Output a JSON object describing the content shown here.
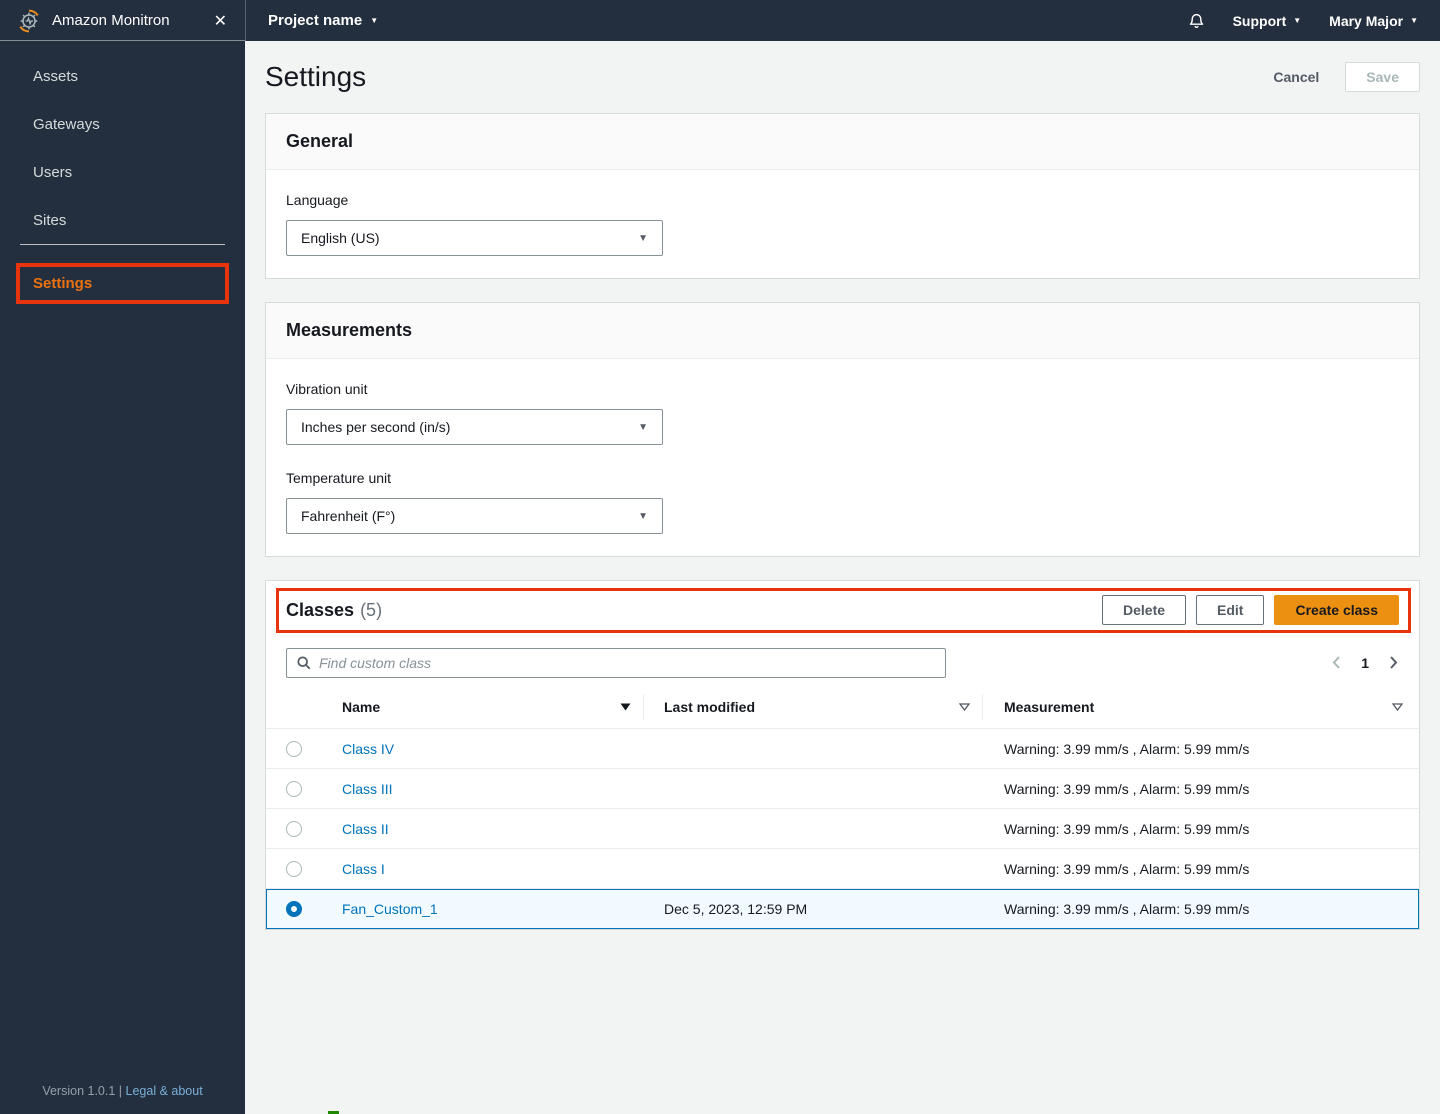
{
  "topbar": {
    "project": "Project name",
    "support": "Support",
    "user": "Mary Major"
  },
  "sidebar": {
    "app_name": "Amazon Monitron",
    "items": [
      {
        "label": "Assets"
      },
      {
        "label": "Gateways"
      },
      {
        "label": "Users"
      },
      {
        "label": "Sites"
      }
    ],
    "settings_label": "Settings",
    "version": "Version 1.0.1",
    "footer_divider": "|",
    "legal_link": "Legal & about"
  },
  "page": {
    "title": "Settings",
    "cancel_label": "Cancel",
    "save_label": "Save"
  },
  "general": {
    "title": "General",
    "language_label": "Language",
    "language_value": "English (US)"
  },
  "measurements": {
    "title": "Measurements",
    "vibration_label": "Vibration unit",
    "vibration_value": "Inches per second (in/s)",
    "temperature_label": "Temperature unit",
    "temperature_value": "Fahrenheit (F°)"
  },
  "classes": {
    "title": "Classes",
    "count": "(5)",
    "buttons": {
      "delete": "Delete",
      "edit": "Edit",
      "create": "Create class"
    },
    "search_placeholder": "Find custom class",
    "pagination": {
      "page": "1"
    },
    "table": {
      "columns": [
        "Name",
        "Last modified",
        "Measurement"
      ],
      "rows": [
        {
          "name": "Class IV",
          "modified": "",
          "measurement": "Warning: 3.99 mm/s , Alarm: 5.99 mm/s",
          "selected": false
        },
        {
          "name": "Class III",
          "modified": "",
          "measurement": "Warning: 3.99 mm/s , Alarm: 5.99 mm/s",
          "selected": false
        },
        {
          "name": "Class II",
          "modified": "",
          "measurement": "Warning: 3.99 mm/s , Alarm: 5.99 mm/s",
          "selected": false
        },
        {
          "name": "Class I",
          "modified": "",
          "measurement": "Warning: 3.99 mm/s , Alarm: 5.99 mm/s",
          "selected": false
        },
        {
          "name": "Fan_Custom_1",
          "modified": "Dec 5, 2023, 12:59 PM",
          "measurement": "Warning: 3.99 mm/s , Alarm: 5.99 mm/s",
          "selected": true
        }
      ]
    }
  },
  "icons": {
    "close": "✕",
    "caret_down": "▼",
    "select_caret": "▼"
  },
  "colors": {
    "topbar_bg": "#232f3e",
    "accent_orange": "#ec7211",
    "primary_button": "#ec9012",
    "link_blue": "#0073bb",
    "annotation_red": "#e8340c",
    "selected_row_bg": "#f1faff",
    "page_bg": "#f2f3f3"
  }
}
